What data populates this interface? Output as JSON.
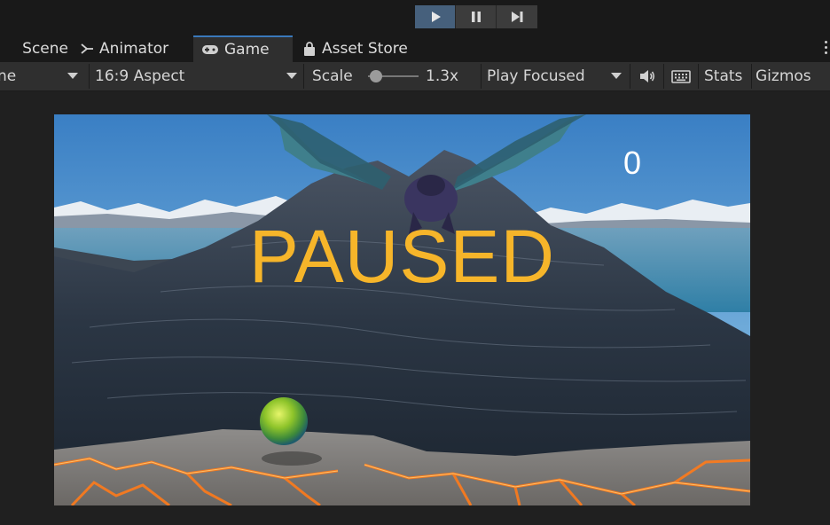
{
  "toolbar": {
    "play_icon": "play-icon",
    "pause_icon": "pause-icon",
    "step_icon": "step-icon",
    "accent_color": "#46607c"
  },
  "tabs": [
    {
      "label": "Scene",
      "icon": "scene-icon"
    },
    {
      "label": "Animator",
      "icon": "animator-icon"
    },
    {
      "label": "Game",
      "icon": "gamepad-icon",
      "active": true
    },
    {
      "label": "Asset Store",
      "icon": "shopping-bag-icon"
    }
  ],
  "game_toolbar": {
    "display_label": "ne",
    "aspect_label": "16:9 Aspect",
    "scale_label": "Scale",
    "scale_value": "1.3x",
    "scale_level": 0.15,
    "play_mode_label": "Play Focused",
    "audio_icon": "speaker-icon",
    "keyboard_icon": "keyboard-icon",
    "stats_label": "Stats",
    "gizmos_label": "Gizmos"
  },
  "game": {
    "paused_text": "PAUSED",
    "score": "0",
    "paused_color": "#f6b52a"
  }
}
